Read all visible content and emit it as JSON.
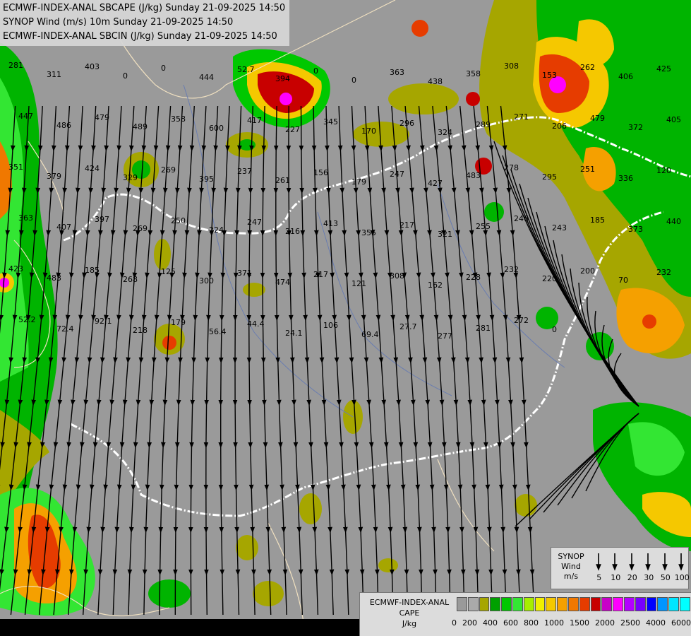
{
  "titles": [
    "ECMWF-INDEX-ANAL SBCAPE (J/kg) Sunday 21-09-2025 14:50",
    "SYNOP Wind (m/s) 10m Sunday 21-09-2025 14:50",
    "ECMWF-INDEX-ANAL SBCIN (J/kg) Sunday 21-09-2025 14:50"
  ],
  "synop_legend": {
    "title": "SYNOP",
    "subtitle": "Wind",
    "unit": "m/s",
    "values": [
      "5",
      "10",
      "20",
      "30",
      "50",
      "100"
    ]
  },
  "cape_legend": {
    "title_line1": "ECMWF-INDEX-ANAL",
    "title_line2": "CAPE",
    "unit": "J/kg",
    "ticks": [
      "0",
      "200",
      "400",
      "600",
      "800",
      "1000",
      "1500",
      "2000",
      "2500",
      "4000",
      "6000"
    ],
    "colors": [
      "#9a9a9a",
      "#aaaaaa",
      "#a6a600",
      "#00a000",
      "#00c800",
      "#33e633",
      "#a6ee00",
      "#f0f000",
      "#f5c800",
      "#f5a000",
      "#f07800",
      "#e63c00",
      "#c80000",
      "#c800c8",
      "#ff00ff",
      "#b400ff",
      "#7800ff",
      "#0000ff",
      "#0096ff",
      "#00e6ff",
      "#00ffff",
      "#ffffff"
    ]
  },
  "colors": {
    "background": "#9a9a9a",
    "border": "#ffffff",
    "streamline": "#000000"
  },
  "map_labels": [
    "281",
    "311",
    "403",
    "0",
    "0",
    "444",
    "52.7",
    "394",
    "0",
    "0",
    "363",
    "438",
    "358",
    "308",
    "153",
    "262",
    "406",
    "425",
    "447",
    "486",
    "479",
    "489",
    "358",
    "600",
    "417",
    "227",
    "345",
    "170",
    "296",
    "324",
    "289",
    "271",
    "206",
    "479",
    "372",
    "405",
    "351",
    "379",
    "424",
    "329",
    "269",
    "395",
    "237",
    "261",
    "156",
    "179",
    "247",
    "427",
    "483",
    "278",
    "295",
    "251",
    "336",
    "120",
    "363",
    "407",
    "397",
    "269",
    "250",
    "224",
    "247",
    "216",
    "413",
    "355",
    "217",
    "321",
    "255",
    "246",
    "243",
    "185",
    "373",
    "440",
    "423",
    "483",
    "185",
    "268",
    "125",
    "300",
    "371",
    "474",
    "217",
    "121",
    "308",
    "162",
    "228",
    "232",
    "220",
    "200",
    "70",
    "232",
    "52.2",
    "72.4",
    "92.1",
    "218",
    "179",
    "56.4",
    "44.4",
    "24.1",
    "106",
    "69.4",
    "27.7",
    "277",
    "281",
    "272",
    "0"
  ]
}
